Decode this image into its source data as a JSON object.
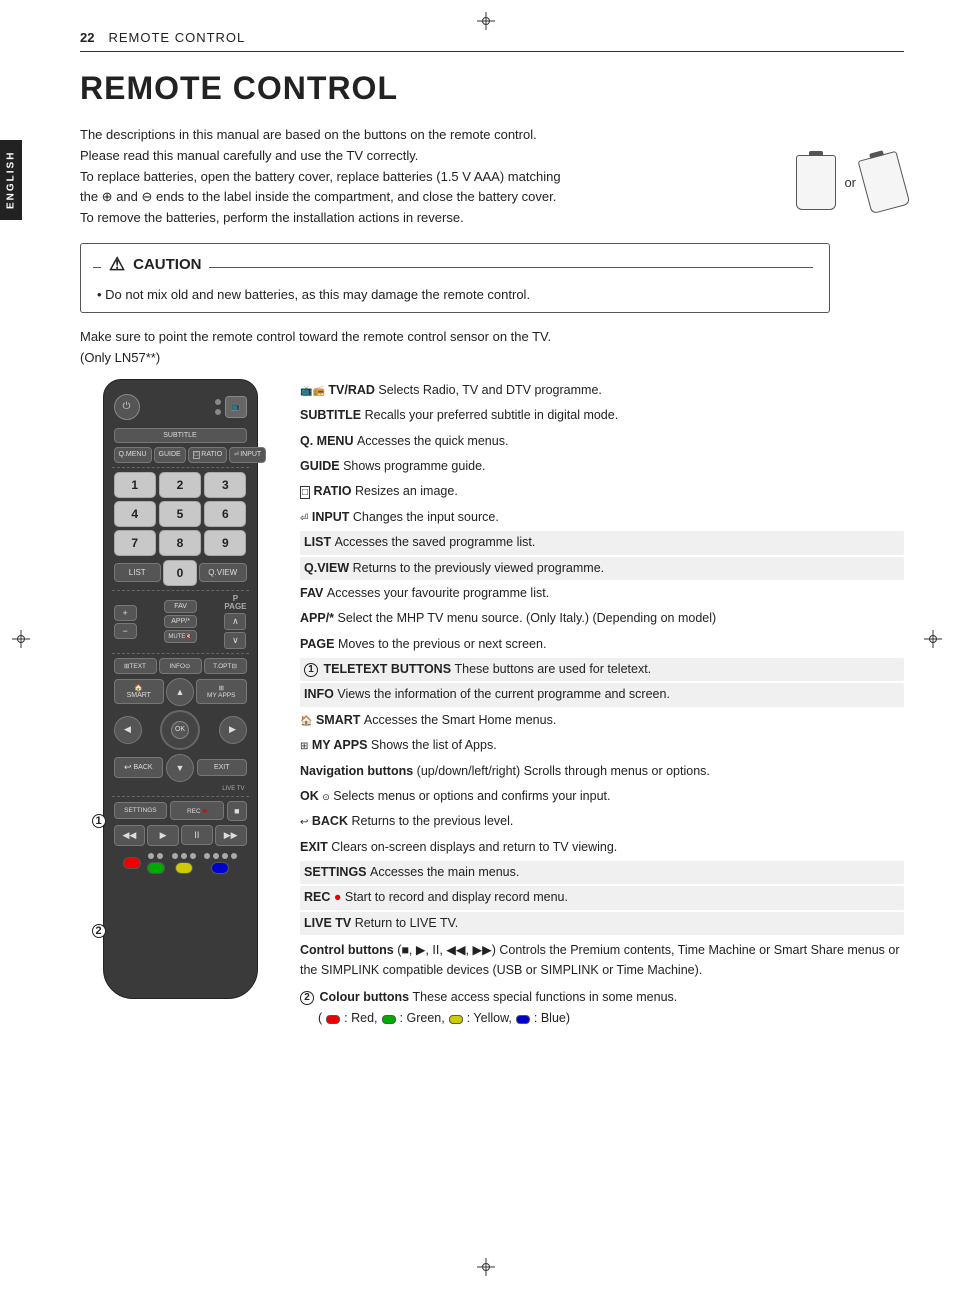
{
  "header": {
    "page_number": "22",
    "title": "REMOTE CONTROL"
  },
  "side_tab": "ENGLISH",
  "main_title": "REMOTE CONTROL",
  "intro": {
    "line1": "The descriptions in this manual are based on the buttons on the remote control.",
    "line2": "Please read this manual carefully and use the TV correctly.",
    "line3": "To replace batteries, open the battery cover, replace batteries (1.5 V AAA) matching",
    "line4": "the ⊕ and ⊖ ends to the label inside the compartment, and close the battery cover.",
    "line5": "To remove the batteries, perform the installation actions in reverse."
  },
  "caution": {
    "title": "CAUTION",
    "bullet": "Do not mix old and new batteries, as this may damage the remote control."
  },
  "make_sure": "Make sure to point the remote control toward the remote control sensor on the TV.",
  "only_note": "(Only LN57**)",
  "descriptions": [
    {
      "key": "TV/RAD",
      "text": "Selects Radio, TV and DTV programme.",
      "icon": "tv-rad-icon",
      "highlighted": false
    },
    {
      "key": "SUBTITLE",
      "text": "Recalls your preferred subtitle in digital mode.",
      "highlighted": false
    },
    {
      "key": "Q. MENU",
      "text": "Accesses the quick menus.",
      "highlighted": false
    },
    {
      "key": "GUIDE",
      "text": "Shows programme guide.",
      "highlighted": false
    },
    {
      "key": "RATIO",
      "text": "Resizes an image.",
      "highlighted": false
    },
    {
      "key": "INPUT",
      "text": "Changes the input source.",
      "highlighted": false
    },
    {
      "key": "LIST",
      "text": "Accesses the saved  programme list.",
      "highlighted": true
    },
    {
      "key": "Q.VIEW",
      "text": "Returns to the previously viewed programme.",
      "highlighted": true
    },
    {
      "key": "FAV",
      "text": "Accesses your favourite programme list.",
      "highlighted": false
    },
    {
      "key": "APP/*",
      "text": "Select the MHP TV menu source. (Only Italy.) (Depending on model)",
      "highlighted": false
    },
    {
      "key": "PAGE",
      "text": "Moves to the previous or next screen.",
      "highlighted": false
    },
    {
      "key": "1 TELETEXT BUTTONS",
      "text": "These buttons are used for teletext.",
      "highlighted": true,
      "numbered": "1"
    },
    {
      "key": "INFO",
      "text": "Views the information of the current programme and screen.",
      "highlighted": true
    },
    {
      "key": "SMART",
      "text": "Accesses the Smart Home menus.",
      "highlighted": false
    },
    {
      "key": "MY APPS",
      "text": "Shows the list of Apps.",
      "highlighted": false
    },
    {
      "key": "Navigation buttons",
      "text": "(up/down/left/right) Scrolls through menus or options.",
      "highlighted": false
    },
    {
      "key": "OK",
      "text": "Selects menus or options and confirms your input.",
      "highlighted": false
    },
    {
      "key": "BACK",
      "text": "Returns to the previous level.",
      "highlighted": false
    },
    {
      "key": "EXIT",
      "text": "Clears on-screen displays and return to TV viewing.",
      "highlighted": false
    },
    {
      "key": "SETTINGS",
      "text": "Accesses the main menus.",
      "highlighted": true
    },
    {
      "key": "REC",
      "text": "Start to record and display record menu.",
      "highlighted": true,
      "rec_dot": true
    },
    {
      "key": "LIVE TV",
      "text": "Return to LIVE TV.",
      "highlighted": true
    },
    {
      "key": "Control buttons",
      "text": "(■, ▶, II, ◀◀, ▶▶) Controls the Premium contents, Time Machine or Smart Share menus or the SIMPLINK compatible devices (USB or SIMPLINK or Time Machine).",
      "highlighted": false
    },
    {
      "key": "2 Colour buttons",
      "text": "These access special functions in some menus.\n(  : Red,   : Green,   : Yellow,   : Blue)",
      "highlighted": false,
      "numbered": "2"
    }
  ],
  "remote": {
    "buttons": {
      "power": "⏻",
      "subtitle": "SUBTITLE",
      "q_menu": "Q.MENU",
      "guide": "GUIDE",
      "ratio": "RATIO",
      "input": "INPUT",
      "nums": [
        "1",
        "2",
        "3",
        "4",
        "5",
        "6",
        "7",
        "8",
        "9"
      ],
      "zero": "0",
      "list": "LIST",
      "q_view": "Q.VIEW",
      "plus": "+",
      "minus": "−",
      "fav": "FAV",
      "app": "APP/*",
      "mute": "MUTE🔇",
      "page_up": "∧",
      "page_down": "∨",
      "text": "TEXT",
      "info": "INFO",
      "t_opt": "T.OPT",
      "smart": "SMART",
      "my_apps": "MY APPS",
      "ok": "OK",
      "back": "BACK",
      "exit": "EXIT",
      "settings": "SETTINGS",
      "rec": "REC",
      "stop": "■",
      "rew": "◀◀",
      "play": "▶",
      "pause": "II",
      "ff": "▶▶"
    }
  }
}
